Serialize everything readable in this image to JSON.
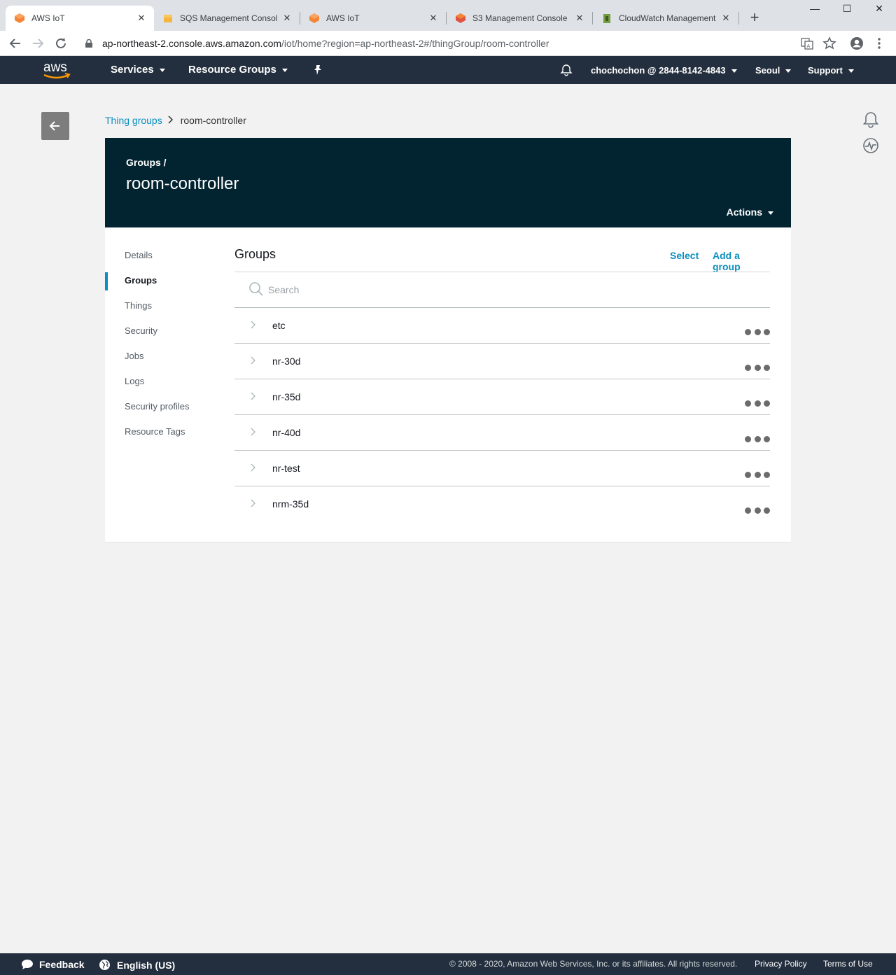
{
  "browser": {
    "tabs": [
      {
        "title": "AWS IoT",
        "icon": "aws-iot-favicon",
        "color": "#f58536",
        "active": true
      },
      {
        "title": "SQS Management Console",
        "icon": "sqs-favicon",
        "color": "#f7b43c",
        "active": false
      },
      {
        "title": "AWS IoT",
        "icon": "aws-iot-favicon",
        "color": "#f58536",
        "active": false
      },
      {
        "title": "S3 Management Console",
        "icon": "s3-favicon",
        "color": "#f58536",
        "active": false
      },
      {
        "title": "CloudWatch Management",
        "icon": "cloudwatch-favicon",
        "color": "#759c3e",
        "active": false
      }
    ],
    "url_host": "ap-northeast-2.console.aws.amazon.com",
    "url_path": "/iot/home?region=ap-northeast-2#/thingGroup/room-controller"
  },
  "awsnav": {
    "logo": "aws",
    "services": "Services",
    "resource_groups": "Resource Groups",
    "account": "chochochon @ 2844-8142-4843",
    "region": "Seoul",
    "support": "Support"
  },
  "breadcrumb": {
    "parent": "Thing groups",
    "current": "room-controller"
  },
  "header": {
    "crumb": "Groups /",
    "title": "room-controller",
    "actions": "Actions"
  },
  "sidenav": {
    "items": [
      {
        "label": "Details"
      },
      {
        "label": "Groups"
      },
      {
        "label": "Things"
      },
      {
        "label": "Security"
      },
      {
        "label": "Jobs"
      },
      {
        "label": "Logs"
      },
      {
        "label": "Security profiles"
      },
      {
        "label": "Resource Tags"
      }
    ],
    "active": "Groups"
  },
  "groups_panel": {
    "title": "Groups",
    "select_label": "Select",
    "add_label": "Add a group",
    "search_placeholder": "Search",
    "rows": [
      {
        "name": "etc"
      },
      {
        "name": "nr-30d"
      },
      {
        "name": "nr-35d"
      },
      {
        "name": "nr-40d"
      },
      {
        "name": "nr-test"
      },
      {
        "name": "nrm-35d"
      }
    ]
  },
  "footer": {
    "feedback": "Feedback",
    "language": "English (US)",
    "copyright": "© 2008 - 2020, Amazon Web Services, Inc. or its affiliates. All rights reserved.",
    "privacy": "Privacy Policy",
    "terms": "Terms of Use"
  },
  "colors": {
    "nav_bg": "#232f3e",
    "header_bg": "#022431",
    "link": "#0a8fbf",
    "aws_orange": "#ff9900"
  }
}
